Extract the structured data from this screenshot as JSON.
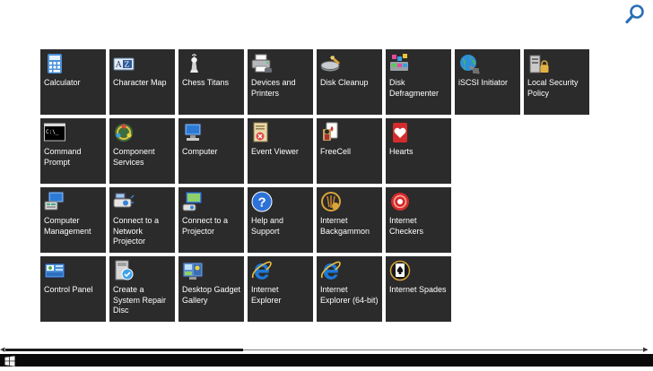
{
  "search": {
    "icon": "search-icon"
  },
  "tiles": [
    {
      "label": "Calculator",
      "icon": "calculator-icon"
    },
    {
      "label": "Character Map",
      "icon": "character-map-icon"
    },
    {
      "label": "Chess Titans",
      "icon": "chess-icon"
    },
    {
      "label": "Devices and Printers",
      "icon": "printer-icon"
    },
    {
      "label": "Disk Cleanup",
      "icon": "disk-cleanup-icon"
    },
    {
      "label": "Disk Defragmenter",
      "icon": "defrag-icon"
    },
    {
      "label": "iSCSI Initiator",
      "icon": "globe-icon"
    },
    {
      "label": "Local Security Policy",
      "icon": "security-policy-icon"
    },
    {
      "label": "Command Prompt",
      "icon": "command-prompt-icon"
    },
    {
      "label": "Component Services",
      "icon": "component-services-icon"
    },
    {
      "label": "Computer",
      "icon": "computer-icon"
    },
    {
      "label": "Event Viewer",
      "icon": "event-viewer-icon"
    },
    {
      "label": "FreeCell",
      "icon": "freecell-icon"
    },
    {
      "label": "Hearts",
      "icon": "hearts-icon"
    },
    {
      "label": "Computer Management",
      "icon": "computer-management-icon"
    },
    {
      "label": "Connect to a Network Projector",
      "icon": "network-projector-icon"
    },
    {
      "label": "Connect to a Projector",
      "icon": "projector-icon"
    },
    {
      "label": "Help and Support",
      "icon": "help-icon"
    },
    {
      "label": "Internet Backgammon",
      "icon": "backgammon-icon"
    },
    {
      "label": "Internet Checkers",
      "icon": "checkers-icon"
    },
    {
      "label": "Control Panel",
      "icon": "control-panel-icon"
    },
    {
      "label": "Create a System Repair Disc",
      "icon": "repair-disc-icon"
    },
    {
      "label": "Desktop Gadget Gallery",
      "icon": "gadget-gallery-icon"
    },
    {
      "label": "Internet Explorer",
      "icon": "internet-explorer-icon"
    },
    {
      "label": "Internet Explorer (64-bit)",
      "icon": "internet-explorer-64-icon"
    },
    {
      "label": "Internet Spades",
      "icon": "spades-icon"
    }
  ],
  "scrollbar": {
    "position": 0.0,
    "visible_fraction": 0.37
  },
  "taskbar": {
    "start_icon": "windows-start-icon"
  }
}
